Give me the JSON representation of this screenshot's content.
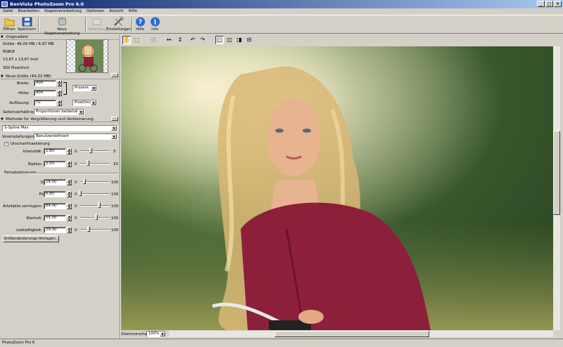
{
  "window": {
    "title": "BenVista PhotoZoom Pro 6.0",
    "buttons": [
      "_",
      "□",
      "×"
    ]
  },
  "menu": [
    "Datei",
    "Bearbeiten",
    "Stapelverarbeitung",
    "Optionen",
    "Ansicht",
    "Hilfe"
  ],
  "toolbar": {
    "open": "Öffnen",
    "save": "Speichern",
    "batch": "Neue Stapelverarbeitung",
    "preview": "Vorschau",
    "settings": "Einstellungen",
    "help": "Hilfe",
    "info": "Info"
  },
  "original": {
    "header": "Originalbild",
    "size": "Größe: 48,09 MB / 6,97 MB",
    "mode": "RGB/8",
    "dimensions": "13,67 x 13,67 Inch",
    "resolution": "300 Pixel/Inch"
  },
  "newsize": {
    "header": "Neue Größe (44,32 MB)",
    "width_label": "Breite:",
    "width_value": "400",
    "height_label": "Höhe:",
    "height_value": "400",
    "res_label": "Auflösung:",
    "res_value": "72",
    "unit": "Prozent",
    "res_unit": "Pixel/Inch",
    "aspect_label": "Seitenverhältnis:",
    "aspect_value": "Proportionen beibehalten"
  },
  "method": {
    "header": "Methode für Vergrößerung und Verkleinerung",
    "algorithm": "S-Spline Max",
    "presets_label": "Voreinstellungen:",
    "presets_value": "Benutzerdefiniert",
    "unsharp_label": "Unscharfmaskierung",
    "intensity_label": "Intensität:",
    "intensity_value": "1,80",
    "intensity_min": "0",
    "intensity_max": "5",
    "intensity_level": 0.36,
    "radius_label": "Radius:",
    "radius_value": "2,50",
    "radius_min": "0",
    "radius_max": "10",
    "radius_level": 0.25,
    "fine_header": "Feinabstimmung",
    "sharpness_label": "Schärfe:",
    "sharpness_value": "14,00",
    "sharpness_level": 0.14,
    "grain_label": "Filmkorn:",
    "grain_value": "0,80",
    "grain_level": 0.008,
    "artifact_label": "Artefakte verringern:",
    "artifact_value": "64,00",
    "artifact_level": 0.64,
    "clarity_label": "Klarheit:",
    "clarity_value": "55,00",
    "clarity_level": 0.55,
    "vivid_label": "Lebhaftigkeit:",
    "vivid_value": "29,00",
    "vivid_level": 0.29,
    "min0": "0",
    "max100": "100",
    "templates_button": "Größenänderungs-Vorlagen..."
  },
  "zoom": {
    "label": "Zoomvorschau:",
    "value": "100%"
  },
  "status": "PhotoZoom Pro 6"
}
